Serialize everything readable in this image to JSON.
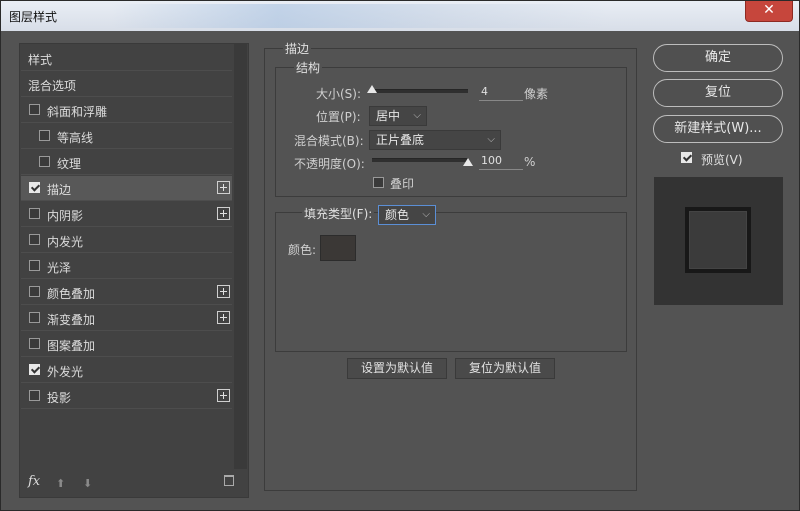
{
  "window": {
    "title": "图层样式",
    "close_glyph": "✕"
  },
  "left_panel": {
    "items": [
      {
        "label": "样式",
        "checkbox": false,
        "checked": false,
        "plus": false,
        "selected": false
      },
      {
        "label": "混合选项",
        "checkbox": false,
        "checked": false,
        "plus": false,
        "selected": false
      },
      {
        "label": "斜面和浮雕",
        "checkbox": true,
        "checked": false,
        "plus": false,
        "selected": false
      },
      {
        "label": "等高线",
        "checkbox": true,
        "checked": false,
        "plus": false,
        "selected": false,
        "indent": true
      },
      {
        "label": "纹理",
        "checkbox": true,
        "checked": false,
        "plus": false,
        "selected": false,
        "indent": true
      },
      {
        "label": "描边",
        "checkbox": true,
        "checked": true,
        "plus": true,
        "selected": true
      },
      {
        "label": "内阴影",
        "checkbox": true,
        "checked": false,
        "plus": true,
        "selected": false
      },
      {
        "label": "内发光",
        "checkbox": true,
        "checked": false,
        "plus": false,
        "selected": false
      },
      {
        "label": "光泽",
        "checkbox": true,
        "checked": false,
        "plus": false,
        "selected": false
      },
      {
        "label": "颜色叠加",
        "checkbox": true,
        "checked": false,
        "plus": true,
        "selected": false
      },
      {
        "label": "渐变叠加",
        "checkbox": true,
        "checked": false,
        "plus": true,
        "selected": false
      },
      {
        "label": "图案叠加",
        "checkbox": true,
        "checked": false,
        "plus": false,
        "selected": false
      },
      {
        "label": "外发光",
        "checkbox": true,
        "checked": true,
        "plus": false,
        "selected": false
      },
      {
        "label": "投影",
        "checkbox": true,
        "checked": false,
        "plus": true,
        "selected": false
      }
    ],
    "fx_label": "fx",
    "up_glyph": "⬆",
    "down_glyph": "⬇"
  },
  "stroke": {
    "section_title": "描边",
    "structure_title": "结构",
    "size_label": "大小(S):",
    "size_value": "4",
    "size_unit": "像素",
    "size_fraction": 0.0,
    "position_label": "位置(P):",
    "position_value": "居中",
    "blend_label": "混合模式(B):",
    "blend_value": "正片叠底",
    "opacity_label": "不透明度(O):",
    "opacity_value": "100",
    "opacity_unit": "%",
    "opacity_fraction": 1.0,
    "overprint_label": "叠印",
    "fill_type_label": "填充类型(F):",
    "fill_type_value": "颜色",
    "color_label": "颜色:",
    "color_swatch": "#3b3836",
    "set_default_label": "设置为默认值",
    "reset_default_label": "复位为默认值"
  },
  "right": {
    "ok_label": "确定",
    "reset_label": "复位",
    "new_style_label": "新建样式(W)...",
    "preview_label": "预览(V)",
    "preview_checked": true
  },
  "colors": {
    "panel_bg": "#535353",
    "list_bg": "#424242",
    "selected_bg": "#585858",
    "focus_blue": "#5b8fd6"
  }
}
